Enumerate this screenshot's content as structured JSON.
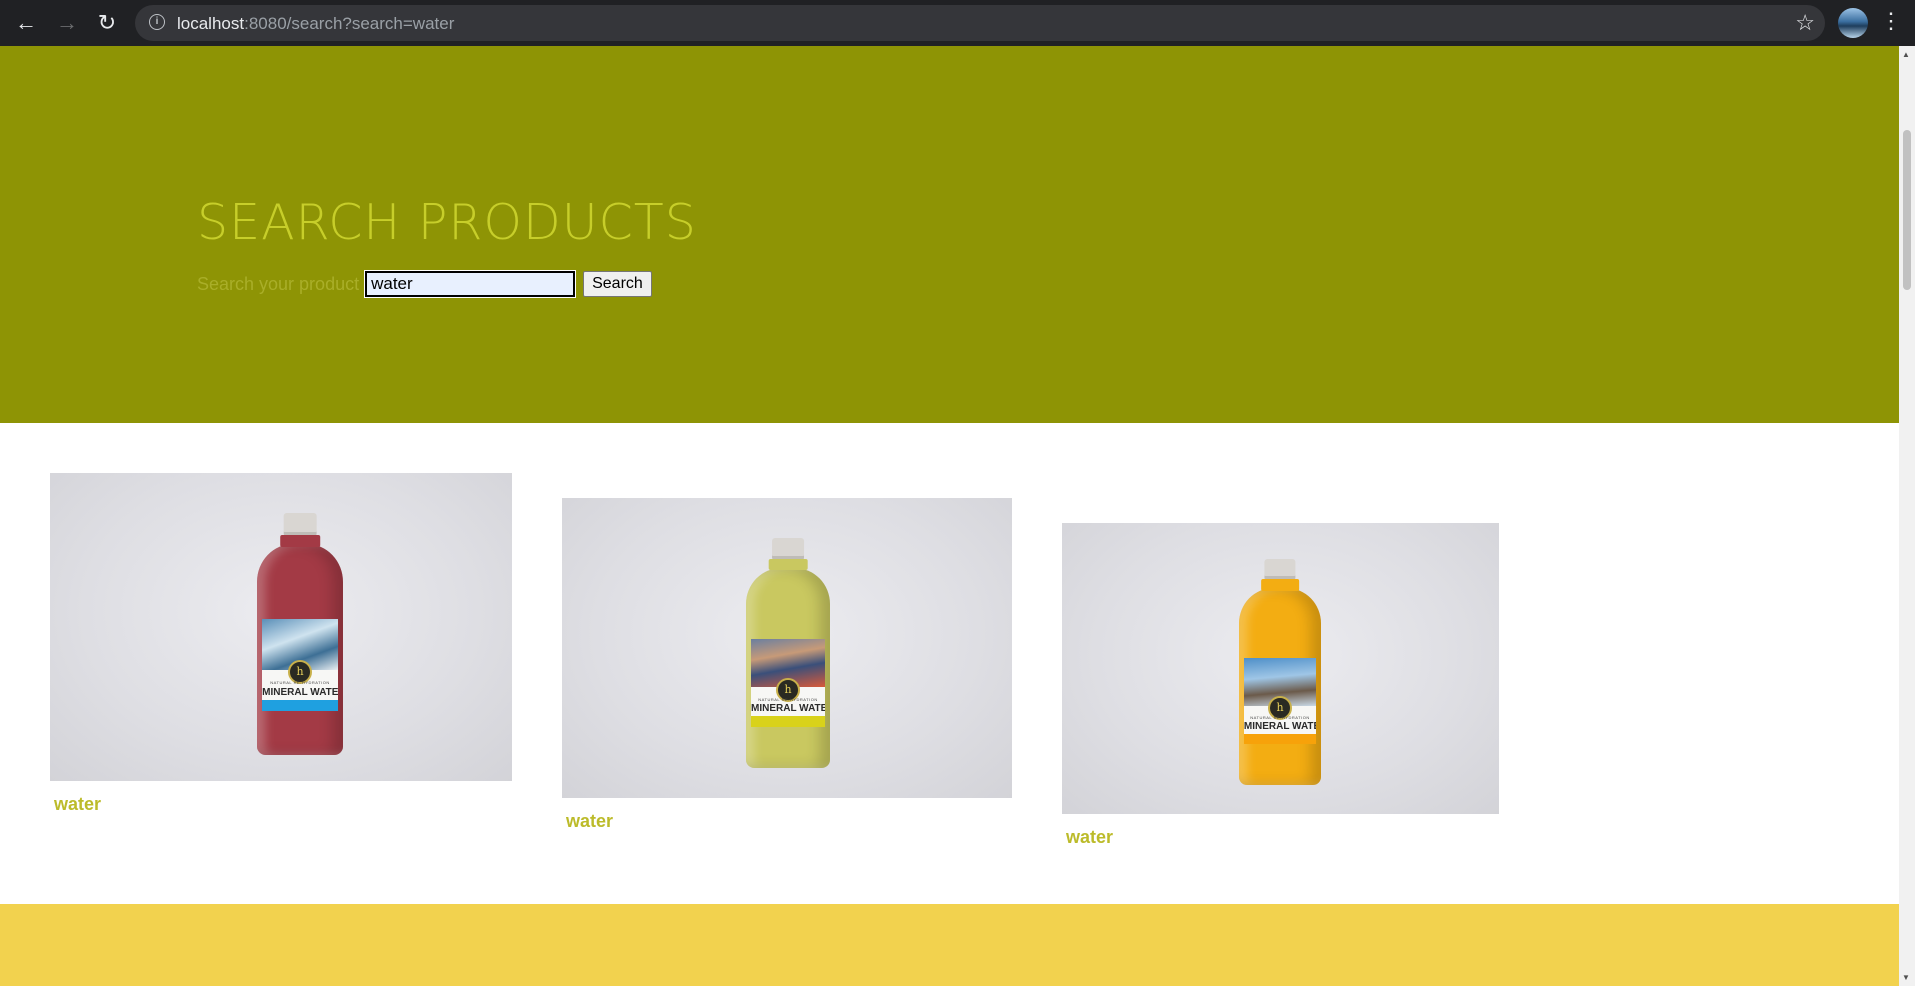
{
  "browser": {
    "url_host": "localhost",
    "url_rest": ":8080/search?search=water"
  },
  "hero": {
    "title": "SEARCH PRODUCTS",
    "search_label": "Search your product",
    "search_value": "water",
    "search_button": "Search"
  },
  "products": [
    {
      "name": "water",
      "flavor_color": "#a33a45",
      "stripe_color": "#1fa0e0",
      "scene": "surfer"
    },
    {
      "name": "water",
      "flavor_color": "#c9c860",
      "stripe_color": "#d9d21a",
      "scene": "runners"
    },
    {
      "name": "water",
      "flavor_color": "#f3ad12",
      "stripe_color": "#f7a20a",
      "scene": "athlete"
    }
  ],
  "colors": {
    "hero_bg": "#8e9405",
    "hero_text": "#c7ce2a",
    "product_link": "#bcbb2a",
    "footer_band": "#f2d24e"
  }
}
